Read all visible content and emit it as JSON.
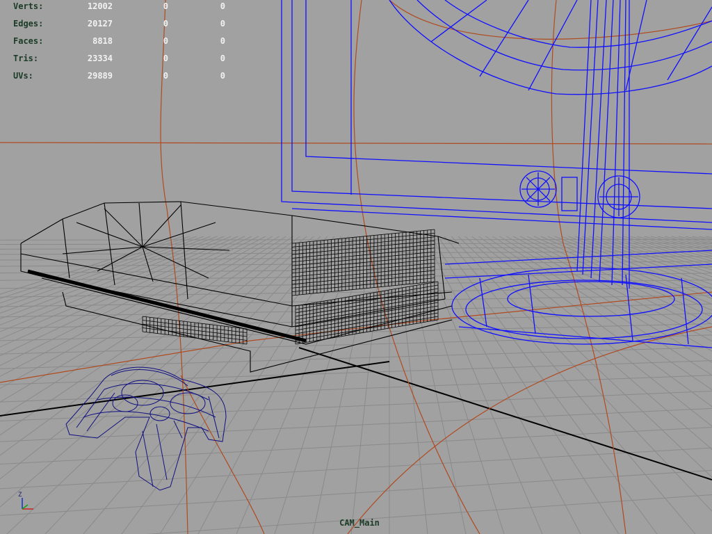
{
  "hud": {
    "rows": [
      {
        "label": "Verts:",
        "value": "12002",
        "selected": "0",
        "components": "0"
      },
      {
        "label": "Edges:",
        "value": "20127",
        "selected": "0",
        "components": "0"
      },
      {
        "label": "Faces:",
        "value": "8818",
        "selected": "0",
        "components": "0"
      },
      {
        "label": "Tris:",
        "value": "23334",
        "selected": "0",
        "components": "0"
      },
      {
        "label": "UVs:",
        "value": "29889",
        "selected": "0",
        "components": "0"
      }
    ]
  },
  "camera": {
    "name": "CAM_Main"
  },
  "axis": {
    "y_label": "Z"
  },
  "colors": {
    "background": "#a1a1a1",
    "grid": "#8c8c8c",
    "wire_selected": "#1010ff",
    "wire_default": "#000000",
    "curve": "#b04a20",
    "controller": "#101080"
  }
}
